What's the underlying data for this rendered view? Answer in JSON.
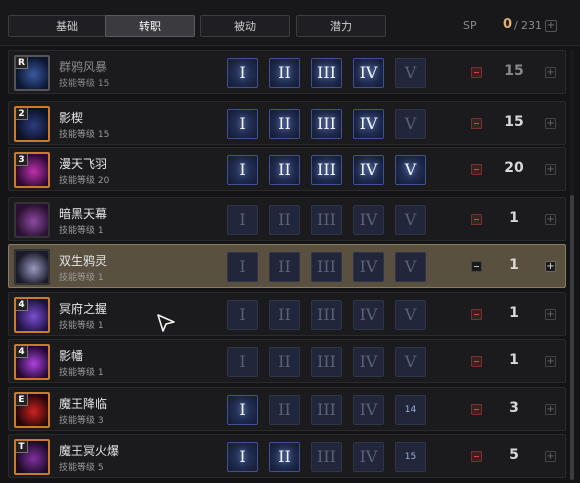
{
  "tabs": [
    {
      "label": "基础",
      "active": false
    },
    {
      "label": "转职",
      "active": true
    },
    {
      "label": "被动",
      "active": false
    },
    {
      "label": "潜力",
      "active": false
    }
  ],
  "sp": {
    "label": "SP",
    "current": "0",
    "separator": "/",
    "max": "231",
    "plus": "+"
  },
  "skills": [
    {
      "badge": "R",
      "name": "群鸦风暴",
      "level_text": "技能等级 15",
      "cells": [
        "I",
        "II",
        "III",
        "IV",
        "V"
      ],
      "count": "15",
      "icon": "raven-storm-icon",
      "state": "dim"
    },
    {
      "badge": "2",
      "name": "影楔",
      "level_text": "技能等级 15",
      "cells": [
        "I",
        "II",
        "III",
        "IV",
        "V"
      ],
      "count": "15",
      "icon": "shadow-wedge-icon",
      "state": "normal"
    },
    {
      "badge": "3",
      "name": "漫天飞羽",
      "level_text": "技能等级 20",
      "cells": [
        "I",
        "II",
        "III",
        "IV",
        "V"
      ],
      "count": "20",
      "icon": "flying-feathers-icon",
      "state": "normal"
    },
    {
      "badge": "",
      "name": "暗黑天幕",
      "level_text": "技能等级 1",
      "cells": [
        "I",
        "II",
        "III",
        "IV",
        "V"
      ],
      "count": "1",
      "icon": "dark-curtain-icon",
      "state": "normal"
    },
    {
      "badge": "",
      "name": "双生鸦灵",
      "level_text": "技能等级 1",
      "cells": [
        "I",
        "II",
        "III",
        "IV",
        "V"
      ],
      "count": "1",
      "icon": "twin-raven-icon",
      "state": "selected"
    },
    {
      "badge": "4",
      "name": "冥府之握",
      "level_text": "技能等级 1",
      "cells": [
        "I",
        "II",
        "III",
        "IV",
        "V"
      ],
      "count": "1",
      "icon": "underworld-grasp-icon",
      "state": "normal"
    },
    {
      "badge": "4",
      "name": "影幡",
      "level_text": "技能等级 1",
      "cells": [
        "I",
        "II",
        "III",
        "IV",
        "V"
      ],
      "count": "1",
      "icon": "shadow-banner-icon",
      "state": "normal"
    },
    {
      "badge": "E",
      "name": "魔王降临",
      "level_text": "技能等级 3",
      "cells": [
        "I",
        "II",
        "III",
        "IV",
        "14"
      ],
      "count": "3",
      "icon": "demon-king-descent-icon",
      "state": "normal"
    },
    {
      "badge": "T",
      "name": "魔王冥火爆",
      "level_text": "技能等级 5",
      "cells": [
        "I",
        "II",
        "III",
        "IV",
        "15"
      ],
      "count": "5",
      "icon": "demon-hellfire-icon",
      "state": "normal"
    }
  ]
}
